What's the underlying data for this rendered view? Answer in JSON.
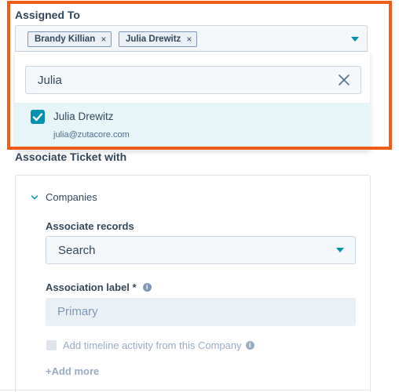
{
  "assigned_to": {
    "title": "Assigned To",
    "selected": [
      {
        "label": "Brandy Killian",
        "remove": "×"
      },
      {
        "label": "Julia Drewitz",
        "remove": "×"
      }
    ],
    "search_value": "Julia",
    "options": [
      {
        "name": "Julia Drewitz",
        "email": "julia@zutacore.com",
        "checked": true
      }
    ]
  },
  "associate": {
    "title": "Associate Ticket with",
    "section": "Companies",
    "records_label": "Associate records",
    "records_value": "Search",
    "association_label": "Association label *",
    "association_value": "Primary",
    "timeline_label": "Add timeline activity from this Company",
    "add_more": "+Add more"
  },
  "colors": {
    "highlight": "#f35c16",
    "accent": "#0091ae",
    "option_bg": "#e5f5f8"
  }
}
